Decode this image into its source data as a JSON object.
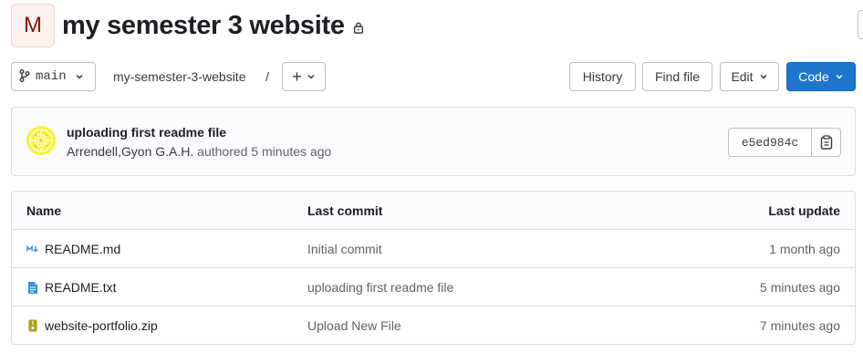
{
  "project": {
    "avatar_letter": "M",
    "title": "my semester 3 website",
    "visibility_icon": "lock-icon"
  },
  "toolbar": {
    "branch": "main",
    "path": "my-semester-3-website",
    "path_separator": "/",
    "add_label": "+",
    "history_label": "History",
    "find_file_label": "Find file",
    "edit_label": "Edit",
    "code_label": "Code"
  },
  "commit": {
    "title": "uploading first readme file",
    "author": "Arrendell,Gyon G.A.H.",
    "authored_text": "authored 5 minutes ago",
    "sha": "e5ed984c"
  },
  "table": {
    "headers": {
      "name": "Name",
      "last_commit": "Last commit",
      "last_update": "Last update"
    },
    "rows": [
      {
        "name": "README.md",
        "icon": "markdown-icon",
        "commit": "Initial commit",
        "updated": "1 month ago"
      },
      {
        "name": "README.txt",
        "icon": "text-file-icon",
        "commit": "uploading first readme file",
        "updated": "5 minutes ago"
      },
      {
        "name": "website-portfolio.zip",
        "icon": "zip-file-icon",
        "commit": "Upload New File",
        "updated": "7 minutes ago"
      }
    ]
  },
  "colors": {
    "primary": "#1f75cb",
    "avatar_bg": "#fcf1ef",
    "avatar_text": "#8d1300",
    "markdown_icon": "#3d8ed6",
    "text_icon": "#428fdc",
    "zip_icon": "#a5a113"
  }
}
